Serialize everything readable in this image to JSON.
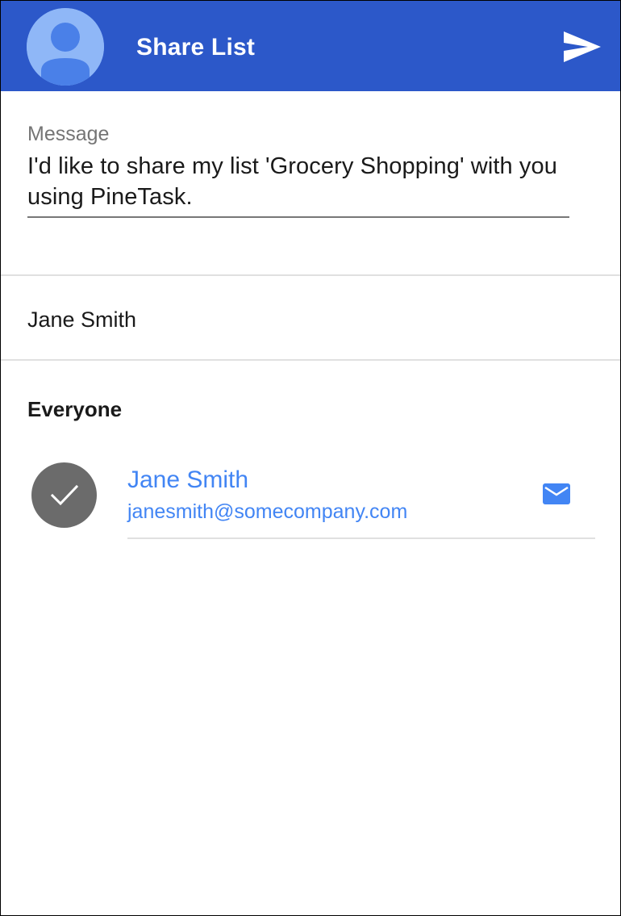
{
  "header": {
    "title": "Share List",
    "background_color": "#2c58c9",
    "avatar_icon": "person-avatar-icon",
    "send_icon": "send-icon"
  },
  "message": {
    "label": "Message",
    "value": "I'd like to share my list 'Grocery Shopping' with you using PineTask."
  },
  "recipient_input": {
    "value": "Jane Smith"
  },
  "contacts_section": {
    "header": "Everyone",
    "contacts": [
      {
        "name": "Jane Smith",
        "email": "janesmith@somecompany.com",
        "selected": true,
        "select_icon": "checkmark-icon",
        "action_icon": "mail-icon",
        "accent_color": "#4285f4"
      }
    ]
  }
}
